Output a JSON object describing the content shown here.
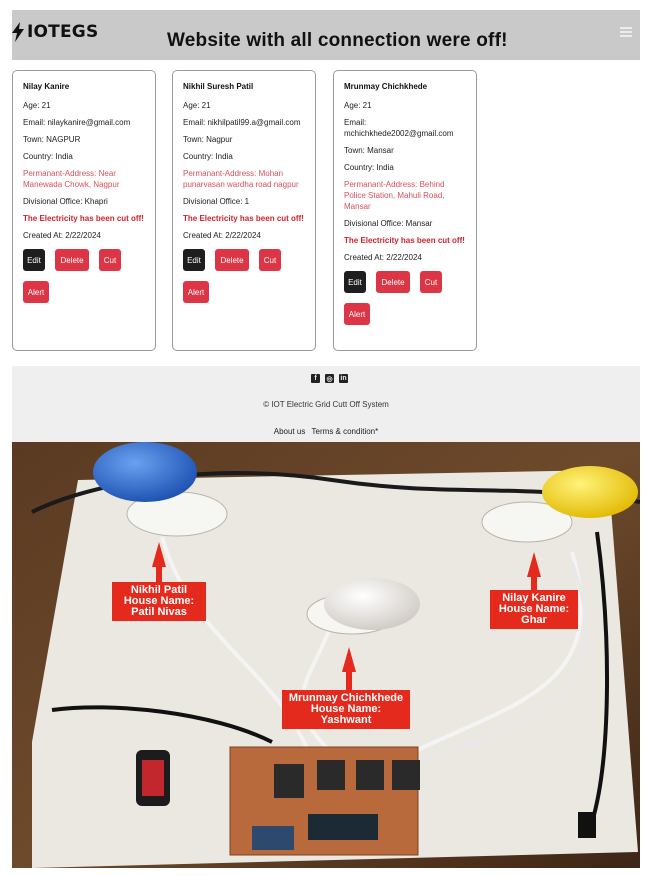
{
  "header": {
    "brand": "IOTEGS",
    "title": "Website with all connection were off!"
  },
  "cards": [
    {
      "name": "Nilay Kanire",
      "age": "Age: 21",
      "email": "Email: nilaykanire@gmail.com",
      "town": "Town: NAGPUR",
      "country": "Country: India",
      "address": "Permanant-Address: Near Manewada Chowk, Nagpur",
      "office": "Divisional Office: Khapri",
      "status": "The Electricity has been cut off!",
      "created": "Created At: 2/22/2024"
    },
    {
      "name": "Nikhil Suresh Patil",
      "age": "Age: 21",
      "email": "Email: nikhilpatil99.a@gmail.com",
      "town": "Town: Nagpur",
      "country": "Country: India",
      "address": "Permanant-Address: Mohan punarvasan wardha road nagpur",
      "office": "Divisional Office: 1",
      "status": "The Electricity has been cut off!",
      "created": "Created At: 2/22/2024"
    },
    {
      "name": "Mrunmay Chichkhede",
      "age": "Age: 21",
      "email": "Email: mchichkhede2002@gmail.com",
      "town": "Town: Mansar",
      "country": "Country: India",
      "address": "Permanant-Address: Behind Police Station, Mahuli Road, Mansar",
      "office": "Divisional Office: Mansar",
      "status": "The Electricity has been cut off!",
      "created": "Created At: 2/22/2024"
    }
  ],
  "buttons": {
    "edit": "Edit",
    "delete": "Delete",
    "cut": "Cut",
    "alert": "Alert"
  },
  "footer": {
    "social_icons": [
      "facebook-icon",
      "instagram-icon",
      "linkedin-icon"
    ],
    "copyright": "© IOT Electric Grid Cutt Off System",
    "about": "About us",
    "terms": "Terms & condition*"
  },
  "photo_labels": {
    "nikhil": [
      "Nikhil Patil",
      "House Name:",
      "Patil Nivas"
    ],
    "nilay": [
      "Nilay Kanire",
      "House Name:",
      "Ghar"
    ],
    "mrunmay": [
      "Mrunmay Chichkhede",
      "House Name:",
      "Yashwant"
    ]
  },
  "colors": {
    "header_bg": "#c9c9c9",
    "danger": "#dc3545",
    "dark_button": "#1e1e1e",
    "address_text": "#d9505a",
    "label_red": "#e32a1c"
  }
}
